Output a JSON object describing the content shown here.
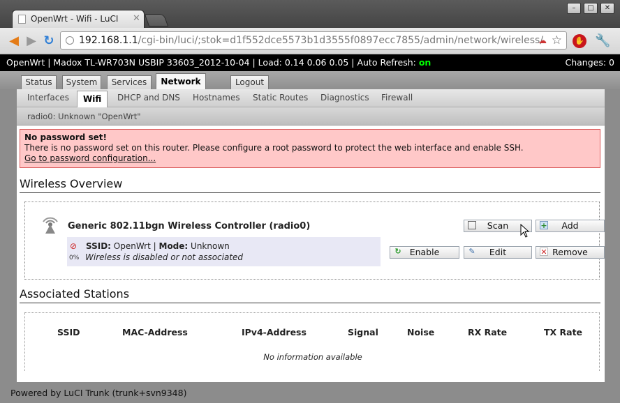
{
  "browser": {
    "tab_title": "OpenWrt - Wifi - LuCI",
    "url_host": "192.168.1.1",
    "url_path": "/cgi-bin/luci/;stok=d1f552dce5573b1d3555f0897ecc7855/admin/network/wireless/"
  },
  "header": {
    "status_line": "OpenWrt | Madox TL-WR703N USBIP 33603_2012-10-04 | Load: 0.14 0.06 0.05 | Auto Refresh: ",
    "auto_refresh_value": "on",
    "changes": "Changes: 0"
  },
  "main_tabs": [
    "Status",
    "System",
    "Services",
    "Network",
    "Logout"
  ],
  "sub_tabs": [
    "Interfaces",
    "Wifi",
    "DHCP and DNS",
    "Hostnames",
    "Static Routes",
    "Diagnostics",
    "Firewall"
  ],
  "subsub_tab": "radio0: Unknown \"OpenWrt\"",
  "alert": {
    "title": "No password set!",
    "message": "There is no password set on this router. Please configure a root password to protect the web interface and enable SSH.",
    "link": "Go to password configuration..."
  },
  "wireless": {
    "heading": "Wireless Overview",
    "controller": "Generic 802.11bgn Wireless Controller (radio0)",
    "scan_label": "Scan",
    "add_label": "Add",
    "ssid_label": "SSID:",
    "ssid_value": " OpenWrt | ",
    "mode_label": "Mode:",
    "mode_value": " Unknown",
    "status": "Wireless is disabled or not associated",
    "signal": "0%",
    "enable_label": "Enable",
    "edit_label": "Edit",
    "remove_label": "Remove"
  },
  "stations": {
    "heading": "Associated Stations",
    "columns": [
      "SSID",
      "MAC-Address",
      "IPv4-Address",
      "Signal",
      "Noise",
      "RX Rate",
      "TX Rate"
    ],
    "empty": "No information available"
  },
  "footer": "Powered by LuCI Trunk (trunk+svn9348)"
}
